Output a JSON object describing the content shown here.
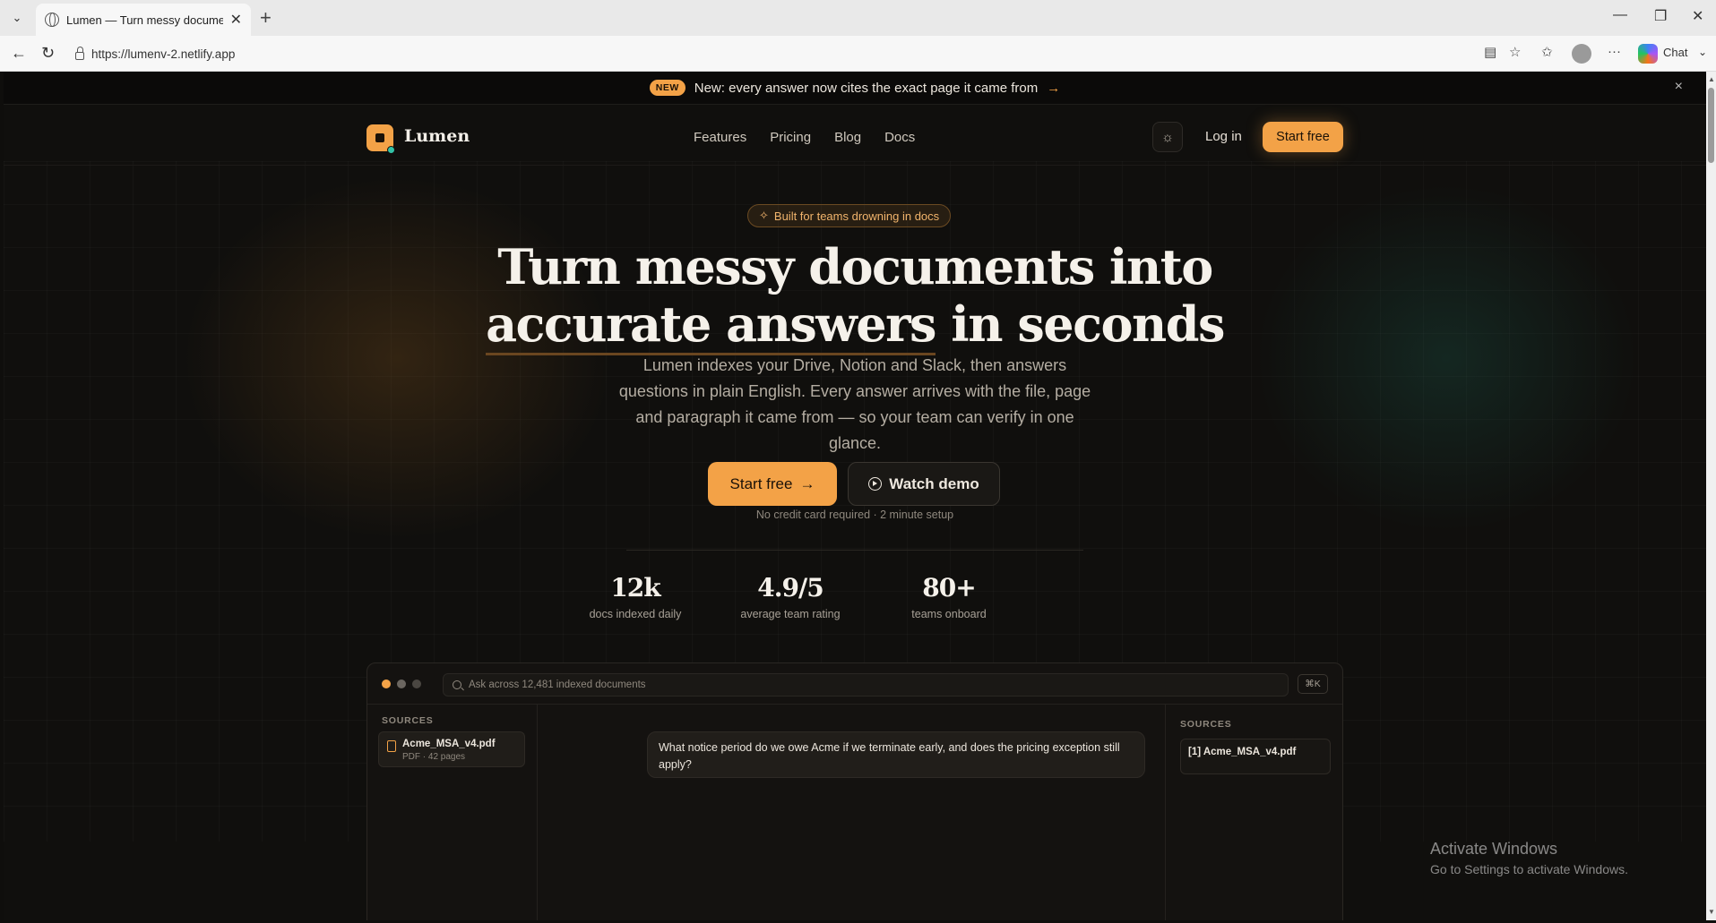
{
  "browser": {
    "tab_title": "Lumen — Turn messy documents into accurate answers",
    "url": "https://lumenv-2.netlify.app",
    "chat_label": "Chat"
  },
  "announcement": {
    "badge": "NEW",
    "text": "New: every answer now cites the exact page it came from",
    "arrow": "→",
    "close": "×"
  },
  "nav": {
    "brand": "Lumen",
    "links": [
      "Features",
      "Pricing",
      "Blog",
      "Docs"
    ],
    "login": "Log in",
    "start": "Start free"
  },
  "hero": {
    "pill": "Built for teams drowning in docs",
    "title_line1": "Turn messy documents into",
    "title_highlight": "accurate answers",
    "title_line2_rest": " in seconds",
    "subtitle": "Lumen indexes your Drive, Notion and Slack, then answers questions in plain English. Every answer arrives with the file, page and paragraph it came from — so your team can verify in one glance.",
    "primary_cta": "Start free",
    "primary_arrow": "→",
    "secondary_cta": "Watch demo",
    "fine_print": "No credit card required · 2 minute setup"
  },
  "stats": [
    {
      "value": "12k",
      "label": "docs indexed daily"
    },
    {
      "value": "4.9/5",
      "label": "average team rating"
    },
    {
      "value": "80+",
      "label": "teams onboard"
    }
  ],
  "app_preview": {
    "search_placeholder": "Ask across 12,481 indexed documents",
    "shortcut": "⌘K",
    "sources_left_heading": "SOURCES",
    "source_item": {
      "name": "Acme_MSA_v4.pdf",
      "meta": "PDF · 42 pages"
    },
    "question": "What notice period do we owe Acme if we terminate early, and does the pricing exception still apply?",
    "sources_right_heading": "SOURCES",
    "citation": "[1] Acme_MSA_v4.pdf"
  },
  "os_watermark": {
    "line1": "Activate Windows",
    "line2": "Go to Settings to activate Windows."
  },
  "colors": {
    "accent": "#f3a247",
    "background": "#100f0d",
    "teal": "#32c1a6"
  }
}
